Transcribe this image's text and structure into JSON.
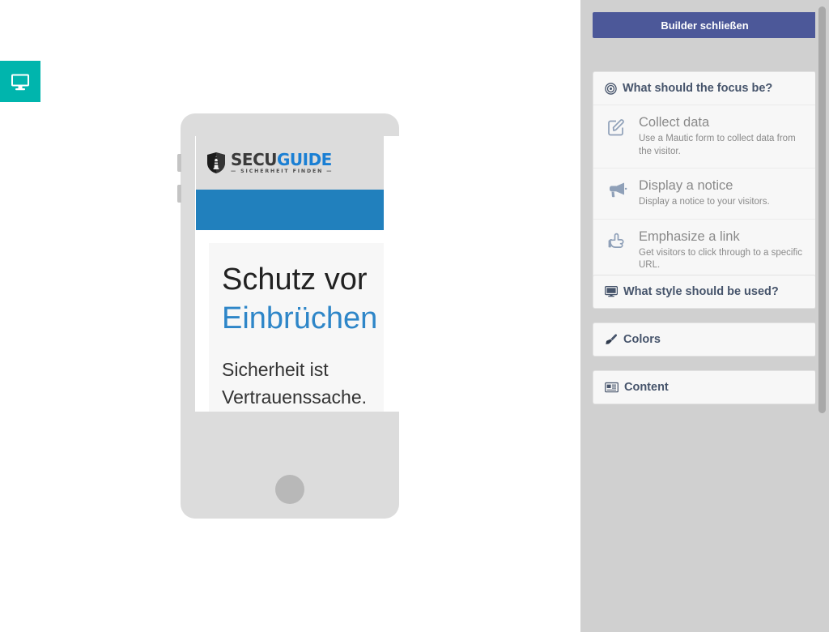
{
  "canvas": {
    "device_toggle": {
      "icon": "desktop-monitor-icon",
      "color": "#00b5ad",
      "title": "Desktop"
    }
  },
  "preview": {
    "device": "mobile",
    "logo": {
      "icon": "shield-lighthouse-icon",
      "word_part1": "SECU",
      "word_part2": "GUIDE",
      "tagline": "— SICHERHEIT FINDEN —",
      "color_part1": "#3a3a3a",
      "color_part2": "#1a7fd4"
    },
    "band_color": "#2180bd",
    "header_bg": "#dcdcdc",
    "heading_line1": "Schutz vor",
    "heading_line2": "Einbrüchen",
    "heading_line2_color": "#2e86c8",
    "body_text": "Sicherheit ist Vertrauenssache. Hier finden Sie"
  },
  "sidebar": {
    "close_button_label": "Builder schließen",
    "close_button_color": "#4c5899",
    "focus_panel": {
      "icon": "bullseye-target-icon",
      "title": "What should the focus be?",
      "items": [
        {
          "icon": "pencil-square-icon",
          "title": "Collect data",
          "description": "Use a Mautic form to collect data from the visitor."
        },
        {
          "icon": "bullhorn-icon",
          "title": "Display a notice",
          "description": "Display a notice to your visitors."
        },
        {
          "icon": "hand-pointer-icon",
          "title": "Emphasize a link",
          "description": "Get visitors to click through to a specific URL."
        }
      ]
    },
    "style_panel": {
      "icon": "desktop-monitor-icon",
      "title": "What style should be used?"
    },
    "colors_panel": {
      "icon": "paintbrush-icon",
      "title": "Colors"
    },
    "content_panel": {
      "icon": "newspaper-icon",
      "title": "Content"
    }
  }
}
